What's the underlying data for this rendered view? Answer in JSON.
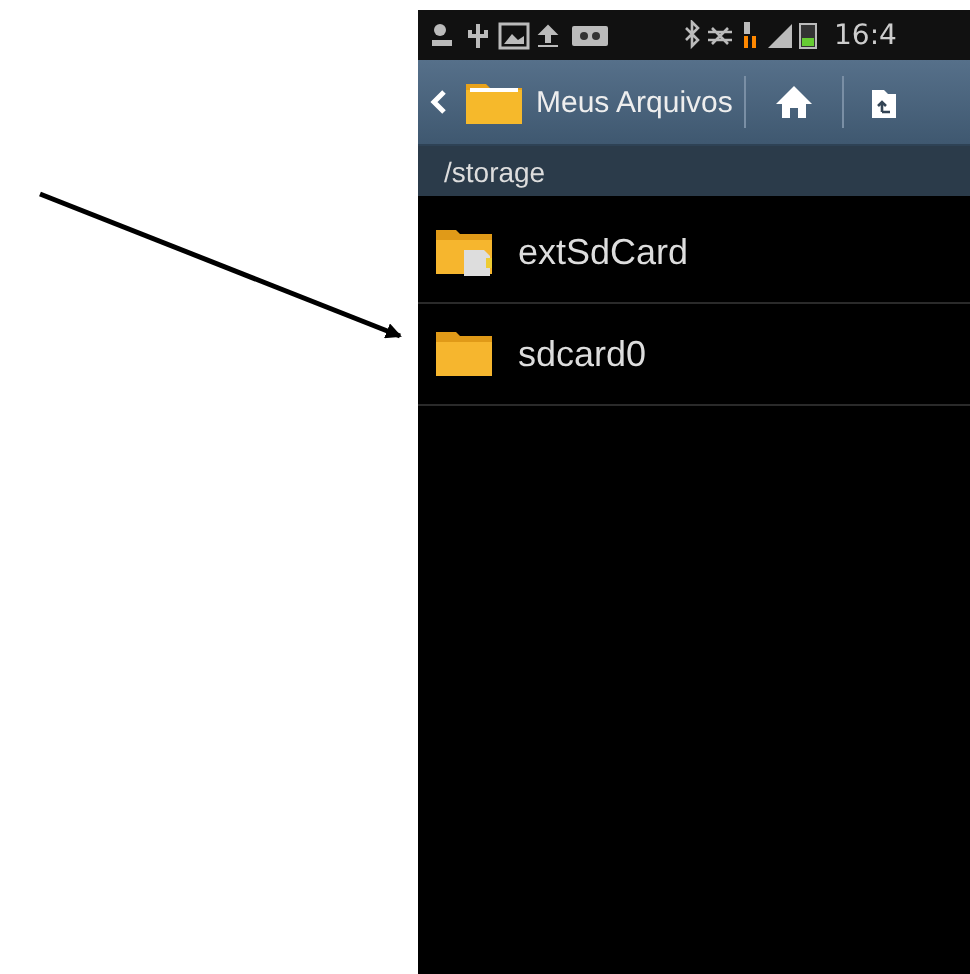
{
  "status_bar": {
    "time": "16:4"
  },
  "action_bar": {
    "title": "Meus Arquivos"
  },
  "path_bar": {
    "path": "/storage"
  },
  "files": [
    {
      "name": "extSdCard",
      "kind": "sdcard"
    },
    {
      "name": "sdcard0",
      "kind": "folder"
    }
  ]
}
